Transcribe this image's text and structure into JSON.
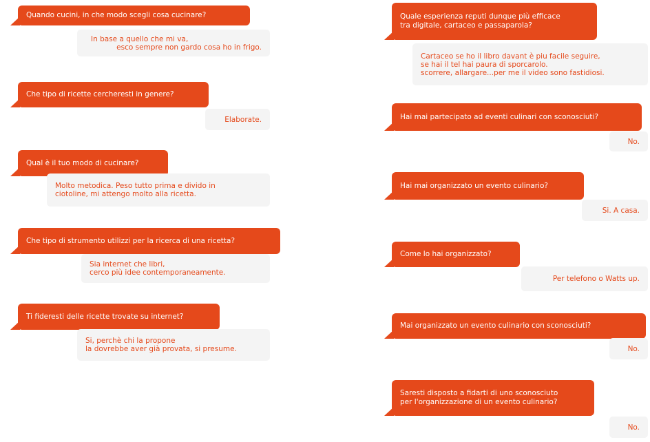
{
  "colors": {
    "question_bg": "#e5491b",
    "question_text": "#ffffff",
    "answer_bg": "#f4f4f4",
    "answer_text": "#e5491b"
  },
  "left": [
    {
      "question": [
        "Quando cucini, in che modo scegli cosa cucinare?"
      ],
      "answer": [
        "In base a quello che mi va,",
        "esco sempre non gardo cosa ho in frigo."
      ]
    },
    {
      "question": [
        "Che tipo di ricette cercheresti in genere?"
      ],
      "answer": [
        "Elaborate."
      ]
    },
    {
      "question": [
        "Qual è il tuo modo di cucinare?"
      ],
      "answer": [
        "Molto metodica. Peso tutto prima e divido in",
        "ciotoline, mi attengo molto alla ricetta."
      ]
    },
    {
      "question": [
        "Che tipo di strumento utilizzi per la ricerca di una ricetta?"
      ],
      "answer": [
        "Sia internet che libri,",
        "cerco più idee contemporaneamente."
      ]
    },
    {
      "question": [
        "Ti fideresti delle ricette trovate su internet?"
      ],
      "answer": [
        "Si, perchè chi la propone",
        "la dovrebbe aver già provata, si presume."
      ]
    }
  ],
  "right": [
    {
      "question": [
        "Quale esperienza reputi dunque più efficace",
        "tra digitale, cartaceo e passaparola?"
      ],
      "answer": [
        "Cartaceo se ho il libro davant è piu facile seguire,",
        "se hai il tel hai paura di sporcarolo.",
        "scorrere, allargare...per me il video sono fastidiosi."
      ]
    },
    {
      "question": [
        "Hai mai partecipato ad eventi culinari con sconosciuti?"
      ],
      "answer": [
        "No."
      ]
    },
    {
      "question": [
        "Hai mai organizzato un evento culinario?"
      ],
      "answer": [
        "Si. A casa."
      ]
    },
    {
      "question": [
        "Come lo hai organizzato?"
      ],
      "answer": [
        "Per telefono o Watts up."
      ]
    },
    {
      "question": [
        "Mai organizzato un evento culinario con sconosciuti?"
      ],
      "answer": [
        "No."
      ]
    },
    {
      "question": [
        "Saresti disposto a fidarti di uno sconosciuto",
        "per l'organizzazione di un evento culinario?"
      ],
      "answer": [
        "No."
      ]
    }
  ]
}
